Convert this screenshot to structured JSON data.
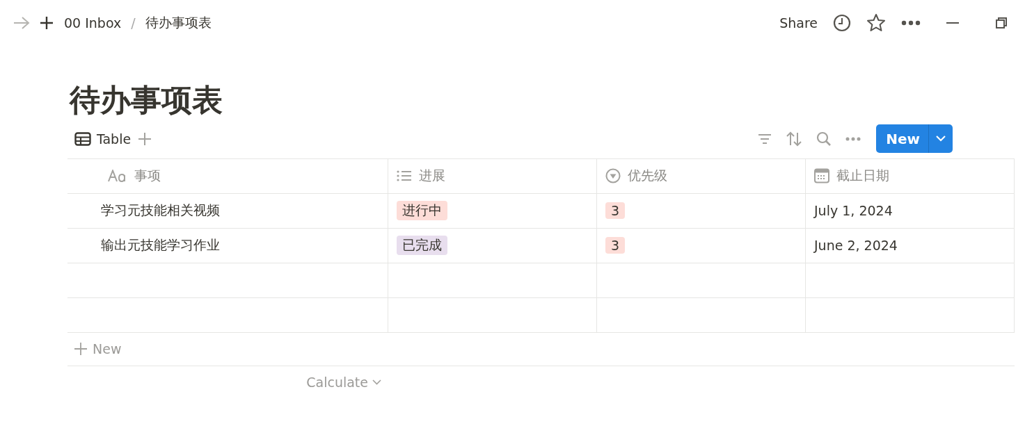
{
  "topbar": {
    "breadcrumb": [
      "00 Inbox",
      "待办事项表"
    ],
    "separator": "/",
    "share": "Share"
  },
  "page": {
    "title": "待办事项表"
  },
  "views": [
    {
      "label": "Table",
      "selected": true
    }
  ],
  "new_button": {
    "label": "New"
  },
  "table": {
    "columns": [
      {
        "label": "事项",
        "kind": "title"
      },
      {
        "label": "进展",
        "kind": "status"
      },
      {
        "label": "优先级",
        "kind": "select"
      },
      {
        "label": "截止日期",
        "kind": "date"
      }
    ],
    "rows": [
      {
        "kind": "item",
        "name": "学习元技能相关视频",
        "status": {
          "label": "进行中",
          "color": "#fdddd8"
        },
        "priority": {
          "label": "3",
          "color": "#fdddd8"
        },
        "date": "July 1, 2024"
      },
      {
        "kind": "item",
        "name": "输出元技能学习作业",
        "status": {
          "label": "已完成",
          "color": "#e8deee"
        },
        "priority": {
          "label": "3",
          "color": "#fdddd8"
        },
        "date": "June 2, 2024"
      },
      {
        "kind": "blank"
      },
      {
        "kind": "blank"
      }
    ],
    "add_row": "New",
    "calculate": "Calculate"
  }
}
